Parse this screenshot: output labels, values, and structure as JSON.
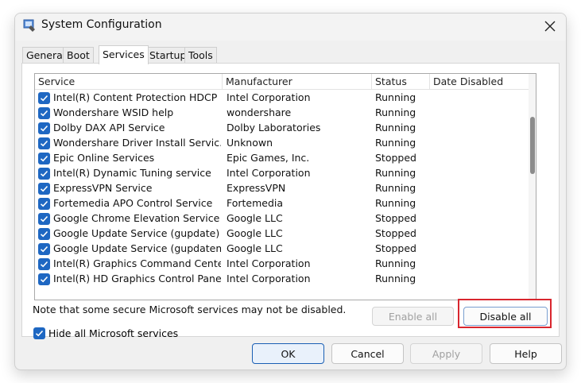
{
  "window": {
    "title": "System Configuration",
    "app_icon": "msconfig-icon",
    "close_icon": "close-icon"
  },
  "tabs": [
    {
      "label": "General",
      "active": false
    },
    {
      "label": "Boot",
      "active": false
    },
    {
      "label": "Services",
      "active": true
    },
    {
      "label": "Startup",
      "active": false
    },
    {
      "label": "Tools",
      "active": false
    }
  ],
  "list": {
    "columns": [
      "Service",
      "Manufacturer",
      "Status",
      "Date Disabled"
    ],
    "rows": [
      {
        "checked": true,
        "service": "Intel(R) Content Protection HDCP ...",
        "manufacturer": "Intel Corporation",
        "status": "Running",
        "date_disabled": ""
      },
      {
        "checked": true,
        "service": "Wondershare WSID help",
        "manufacturer": "wondershare",
        "status": "Running",
        "date_disabled": ""
      },
      {
        "checked": true,
        "service": "Dolby DAX API Service",
        "manufacturer": "Dolby Laboratories",
        "status": "Running",
        "date_disabled": ""
      },
      {
        "checked": true,
        "service": "Wondershare Driver Install Servic...",
        "manufacturer": "Unknown",
        "status": "Running",
        "date_disabled": ""
      },
      {
        "checked": true,
        "service": "Epic Online Services",
        "manufacturer": "Epic Games, Inc.",
        "status": "Stopped",
        "date_disabled": ""
      },
      {
        "checked": true,
        "service": "Intel(R) Dynamic Tuning service",
        "manufacturer": "Intel Corporation",
        "status": "Running",
        "date_disabled": ""
      },
      {
        "checked": true,
        "service": "ExpressVPN Service",
        "manufacturer": "ExpressVPN",
        "status": "Running",
        "date_disabled": ""
      },
      {
        "checked": true,
        "service": "Fortemedia APO Control Service",
        "manufacturer": "Fortemedia",
        "status": "Running",
        "date_disabled": ""
      },
      {
        "checked": true,
        "service": "Google Chrome Elevation Service ...",
        "manufacturer": "Google LLC",
        "status": "Stopped",
        "date_disabled": ""
      },
      {
        "checked": true,
        "service": "Google Update Service (gupdate)",
        "manufacturer": "Google LLC",
        "status": "Stopped",
        "date_disabled": ""
      },
      {
        "checked": true,
        "service": "Google Update Service (gupdatem)",
        "manufacturer": "Google LLC",
        "status": "Stopped",
        "date_disabled": ""
      },
      {
        "checked": true,
        "service": "Intel(R) Graphics Command Cente...",
        "manufacturer": "Intel Corporation",
        "status": "Running",
        "date_disabled": ""
      },
      {
        "checked": true,
        "service": "Intel(R) HD Graphics Control Pane...",
        "manufacturer": "Intel Corporation",
        "status": "Running",
        "date_disabled": ""
      }
    ]
  },
  "note": "Note that some secure Microsoft services may not be disabled.",
  "buttons": {
    "enable_all": "Enable all",
    "disable_all": "Disable all",
    "ok": "OK",
    "cancel": "Cancel",
    "apply": "Apply",
    "help": "Help"
  },
  "hide_ms": {
    "label": "Hide all Microsoft services",
    "checked": true
  },
  "colors": {
    "checkbox": "#1e67c2",
    "highlight": "#d9262e",
    "accent": "#1a5fb4"
  }
}
